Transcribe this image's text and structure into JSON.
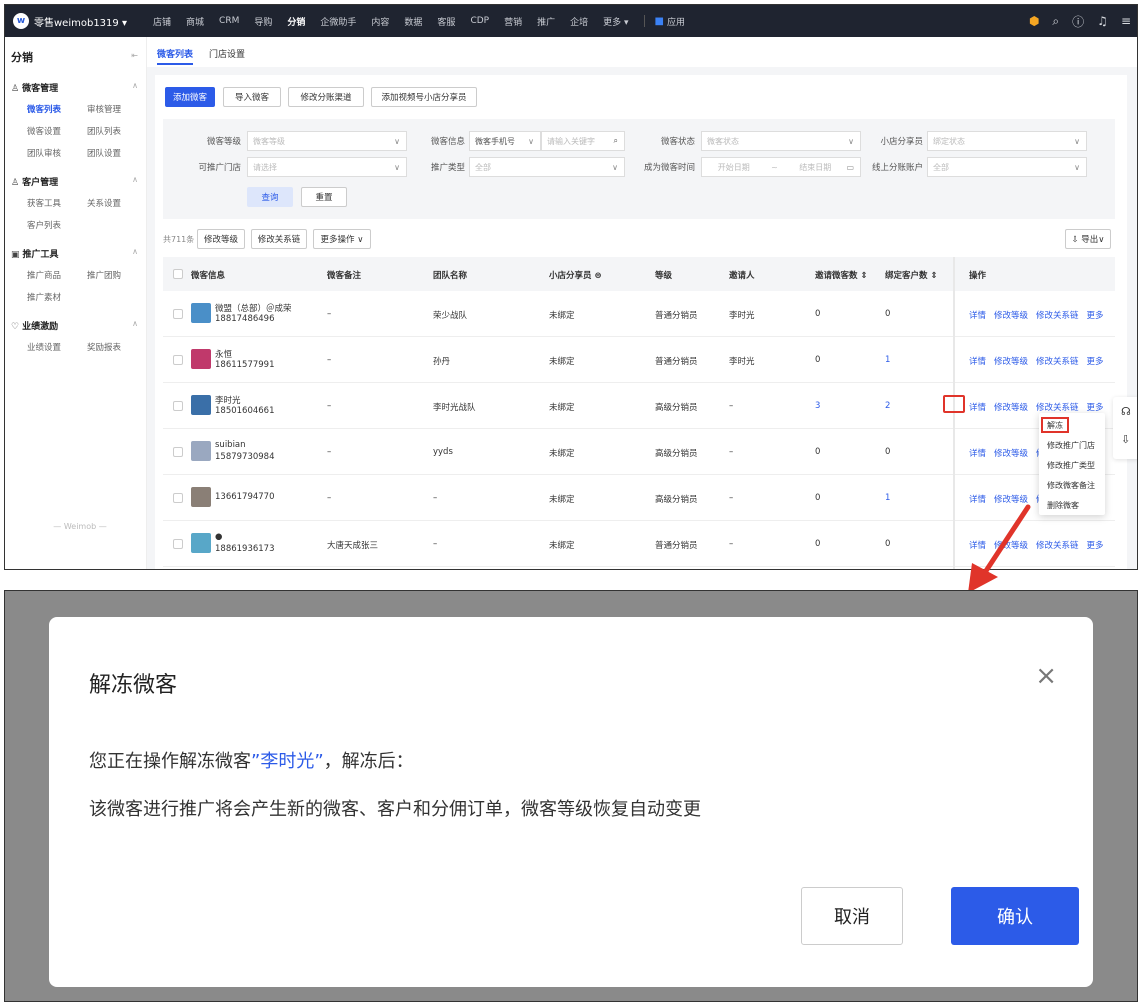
{
  "topbar": {
    "brand": "零售weimob1319 ▾",
    "nav": [
      "店铺",
      "商城",
      "CRM",
      "导购",
      "分销",
      "企微助手",
      "内容",
      "数据",
      "客服",
      "CDP",
      "营销",
      "推广",
      "企培",
      "更多 ▾"
    ],
    "active_nav": "分销",
    "apps": "应用"
  },
  "sidebar": {
    "title": "分销",
    "groups": [
      {
        "label": "微客管理",
        "items": [
          "微客列表",
          "审核管理",
          "微客设置",
          "团队列表",
          "团队审核",
          "团队设置"
        ]
      },
      {
        "label": "客户管理",
        "items": [
          "获客工具",
          "关系设置",
          "客户列表"
        ]
      },
      {
        "label": "推广工具",
        "items": [
          "推广商品",
          "推广团购",
          "推广素材"
        ]
      },
      {
        "label": "业绩激励",
        "items": [
          "业绩设置",
          "奖励报表"
        ]
      }
    ],
    "footer": "— Weimob —"
  },
  "tabs": [
    "微客列表",
    "门店设置"
  ],
  "action_buttons": [
    "添加微客",
    "导入微客",
    "修改分账渠道",
    "添加视频号小店分享员"
  ],
  "filters": {
    "level_label": "微客等级",
    "level_placeholder": "微客等级",
    "info_label": "微客信息",
    "info_type": "微客手机号",
    "info_placeholder": "请输入关键字",
    "status_label": "微客状态",
    "status_placeholder": "微客状态",
    "sharer_label": "小店分享员",
    "sharer_placeholder": "绑定状态",
    "store_label": "可推广门店",
    "store_placeholder": "请选择",
    "type_label": "推广类型",
    "type_value": "全部",
    "time_label": "成为微客时间",
    "time_start": "开始日期",
    "time_sep": "~",
    "time_end": "结束日期",
    "account_label": "线上分账账户",
    "account_value": "全部",
    "query": "查询",
    "reset": "重置"
  },
  "list_toolbar": {
    "total": "共711条",
    "buttons": [
      "修改等级",
      "修改关系链",
      "更多操作 ∨"
    ],
    "export": "⇩ 导出∨"
  },
  "table": {
    "headers": [
      "微客信息",
      "微客备注",
      "团队名称",
      "小店分享员 ⊜",
      "等级",
      "邀请人",
      "邀请微客数 ⇕",
      "绑定客户数 ⇕",
      "操作"
    ],
    "rows": [
      {
        "name": "微盟（总部）＠成荣",
        "phone": "18817486496",
        "remark": "–",
        "team": "荣少战队",
        "sharer": "未绑定",
        "level": "普通分销员",
        "inviter": "李时光",
        "invited": "0",
        "bound": "0",
        "avatar": "#4a8fc8"
      },
      {
        "name": "永恒",
        "phone": "18611577991",
        "remark": "–",
        "team": "孙丹",
        "sharer": "未绑定",
        "level": "普通分销员",
        "inviter": "李时光",
        "invited": "0",
        "bound": "1",
        "avatar": "#c0396b"
      },
      {
        "name": "李时光",
        "phone": "18501604661",
        "remark": "–",
        "team": "李时光战队",
        "sharer": "未绑定",
        "level": "高级分销员",
        "inviter": "–",
        "invited": "3",
        "bound": "2",
        "avatar": "#3a6fa8"
      },
      {
        "name": "suibian",
        "phone": "15879730984",
        "remark": "–",
        "team": "yyds",
        "sharer": "未绑定",
        "level": "高级分销员",
        "inviter": "–",
        "invited": "0",
        "bound": "0",
        "avatar": "#9aa8c0"
      },
      {
        "name": "",
        "phone": "13661794770",
        "remark": "–",
        "team": "–",
        "sharer": "未绑定",
        "level": "高级分销员",
        "inviter": "–",
        "invited": "0",
        "bound": "1",
        "avatar": "#8a7f76"
      },
      {
        "name": "●",
        "phone": "18861936173",
        "remark": "大唐天成张三",
        "team": "–",
        "sharer": "未绑定",
        "level": "普通分销员",
        "inviter": "–",
        "invited": "0",
        "bound": "0",
        "avatar": "#58a7c8"
      }
    ],
    "ops": [
      "详情",
      "修改等级",
      "修改关系链",
      "更多"
    ]
  },
  "dropdown": [
    "解冻",
    "修改推广门店",
    "修改推广类型",
    "修改微客备注",
    "删除微客"
  ],
  "modal": {
    "title": "解冻微客",
    "line1_prefix": "您正在操作解冻微客",
    "line1_name": "”李时光”",
    "line1_suffix": "，解冻后：",
    "line2": "该微客进行推广将会产生新的微客、客户和分佣订单，微客等级恢复自动变更",
    "cancel": "取消",
    "confirm": "确认"
  },
  "colors": {
    "accent": "#2c5be8",
    "highlight": "#e0342a",
    "topbar": "#1f2430"
  }
}
